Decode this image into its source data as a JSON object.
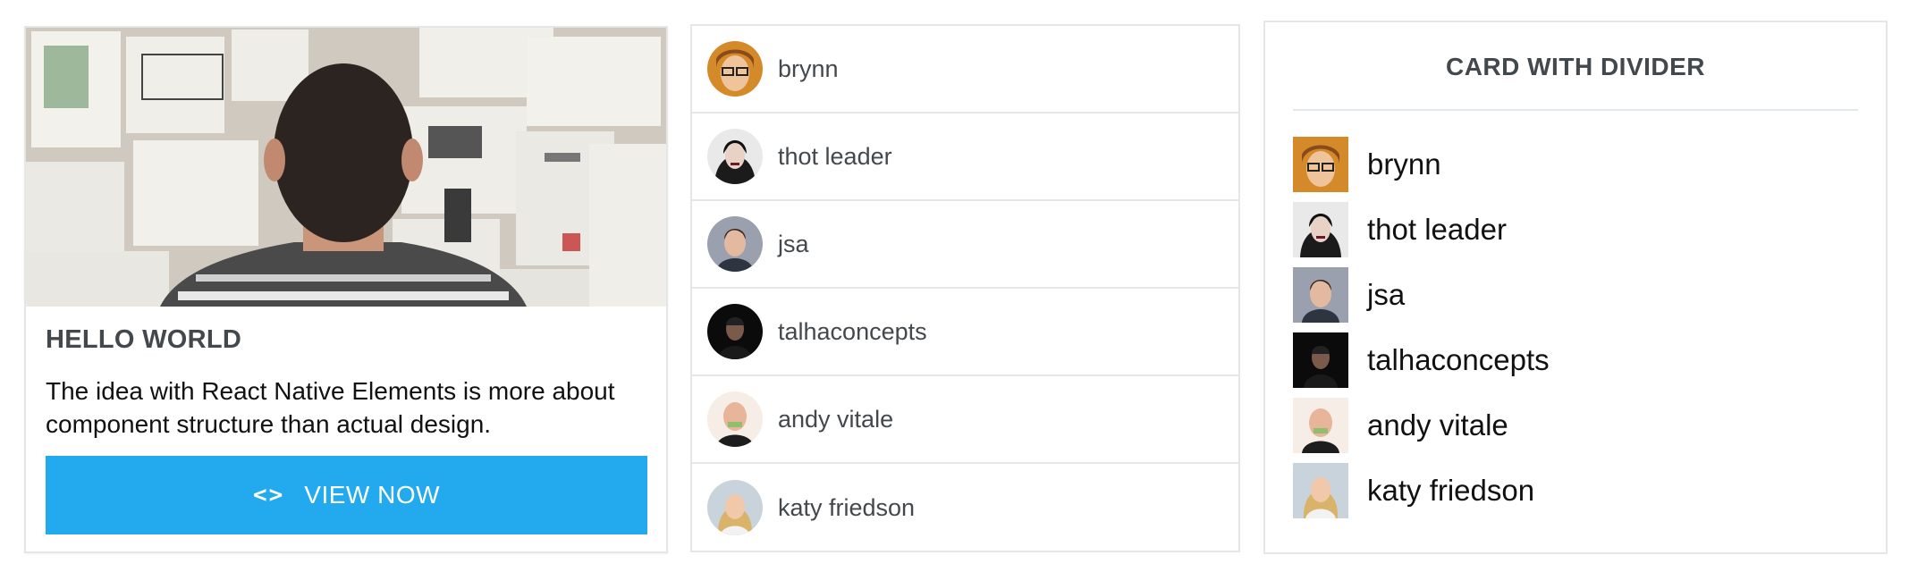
{
  "image_card": {
    "title": "HELLO WORLD",
    "description": "The idea with React Native Elements is more about component structure than actual design.",
    "button_label": "VIEW NOW",
    "button_icon": "code-icon",
    "button_color": "#22a9ee"
  },
  "list_card": {
    "items": [
      {
        "name": "brynn",
        "avatar": "avatar-brynn"
      },
      {
        "name": "thot leader",
        "avatar": "avatar-thot-leader"
      },
      {
        "name": "jsa",
        "avatar": "avatar-jsa"
      },
      {
        "name": "talhaconcepts",
        "avatar": "avatar-talhaconcepts"
      },
      {
        "name": "andy vitale",
        "avatar": "avatar-andy-vitale"
      },
      {
        "name": "katy friedson",
        "avatar": "avatar-katy-friedson"
      }
    ]
  },
  "divider_card": {
    "title": "CARD WITH DIVIDER",
    "users": [
      {
        "name": "brynn"
      },
      {
        "name": "thot leader"
      },
      {
        "name": "jsa"
      },
      {
        "name": "talhaconcepts"
      },
      {
        "name": "andy vitale"
      },
      {
        "name": "katy friedson"
      }
    ]
  }
}
